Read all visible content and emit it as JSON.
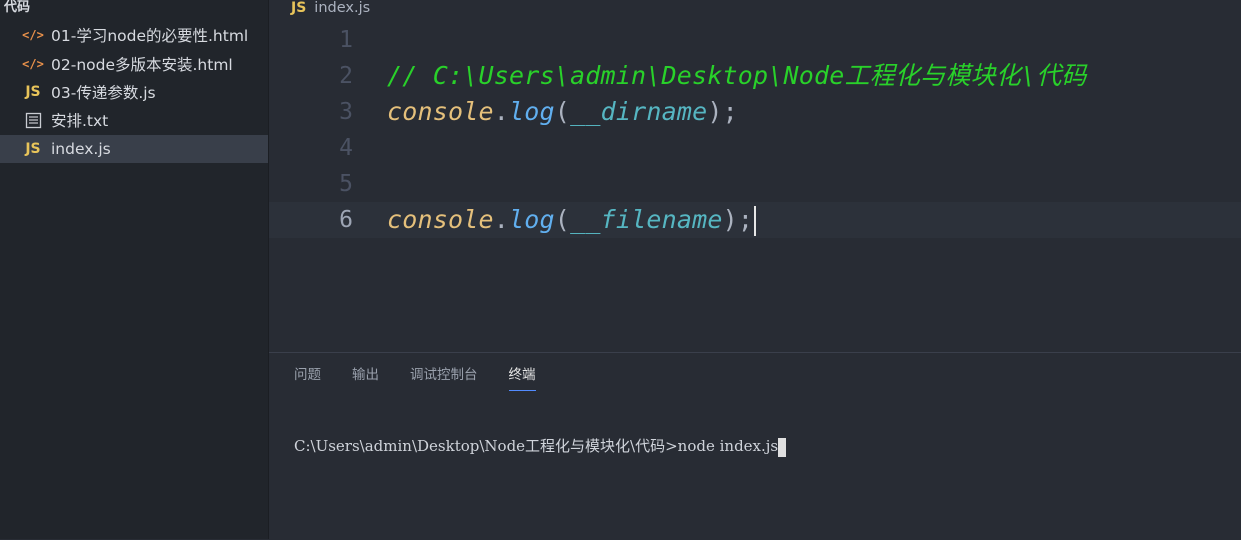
{
  "explorer": {
    "folder": "代码",
    "files": [
      {
        "name": "01-学习node的必要性.html",
        "icon": "html-icon",
        "glyph": "</>"
      },
      {
        "name": "02-node多版本安装.html",
        "icon": "html-icon",
        "glyph": "</>"
      },
      {
        "name": "03-传递参数.js",
        "icon": "js-icon",
        "glyph": "JS"
      },
      {
        "name": "安排.txt",
        "icon": "text-file-icon",
        "glyph": ""
      },
      {
        "name": "index.js",
        "icon": "js-icon",
        "glyph": "JS",
        "active": true
      }
    ]
  },
  "editor": {
    "tab": {
      "glyph": "JS",
      "name": "index.js"
    },
    "lines": [
      {
        "number": "1",
        "comment": ""
      },
      {
        "number": "2",
        "comment": "// C:\\Users\\admin\\Desktop\\Node工程化与模块化\\代码"
      },
      {
        "number": "3",
        "object": "console",
        "dot": ".",
        "method": "log",
        "open": "(",
        "arg": "__dirname",
        "close": ");"
      },
      {
        "number": "4"
      },
      {
        "number": "5"
      },
      {
        "number": "6",
        "object": "console",
        "dot": ".",
        "method": "log",
        "open": "(",
        "arg": "__filename",
        "close": ");"
      }
    ]
  },
  "panel": {
    "tabs": [
      "问题",
      "输出",
      "调试控制台",
      "终端"
    ],
    "active_tab": "终端",
    "terminal_prompt": "C:\\Users\\admin\\Desktop\\Node工程化与模块化\\代码>",
    "terminal_command": "node index.js"
  },
  "colors": {
    "background": "#282c34",
    "sidebar": "#21252b",
    "comment": "#29d12a",
    "object": "#e5c07b",
    "function": "#61afef",
    "variable": "#56b6c2"
  }
}
